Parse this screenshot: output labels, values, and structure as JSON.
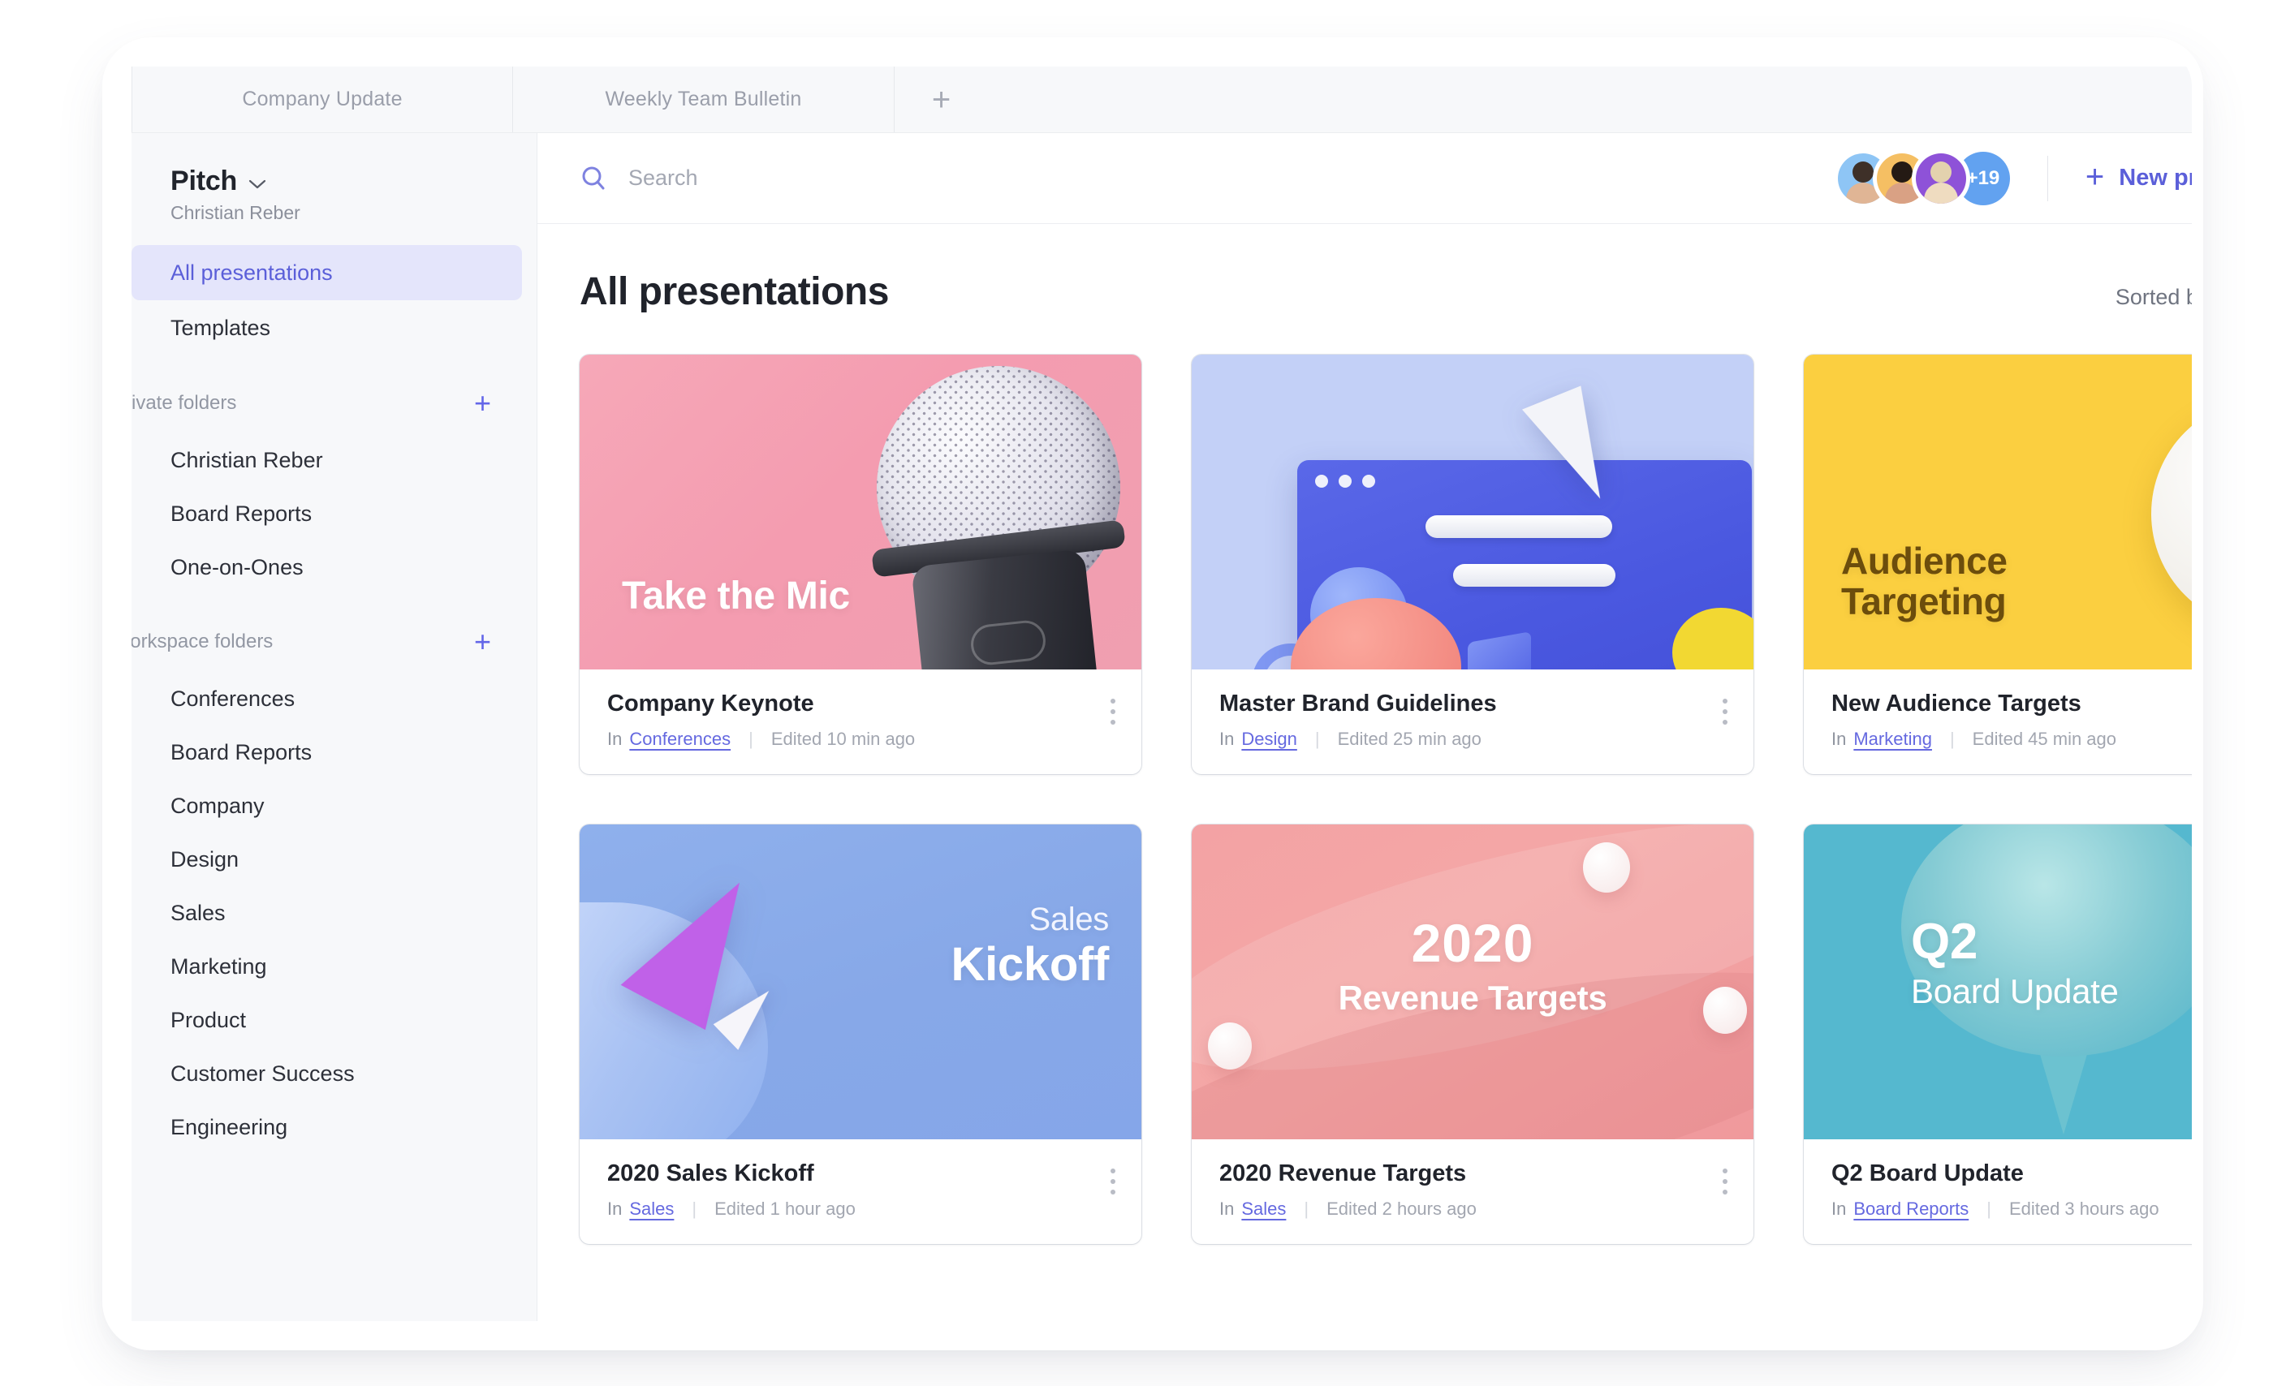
{
  "tabs": [
    {
      "label": "Company Update"
    },
    {
      "label": "Weekly Team Bulletin"
    }
  ],
  "tab_add_label": "+",
  "sidebar": {
    "workspace_name": "Pitch",
    "workspace_caret": "⌄",
    "workspace_owner": "Christian Reber",
    "nav": [
      {
        "label": "All presentations",
        "active": true
      },
      {
        "label": "Templates",
        "active": false
      }
    ],
    "private_section": {
      "label": "Private folders",
      "add_label": "+",
      "folders": [
        {
          "label": "Christian Reber"
        },
        {
          "label": "Board Reports"
        },
        {
          "label": "One-on-Ones"
        }
      ]
    },
    "workspace_section": {
      "label": "Workspace folders",
      "add_label": "+",
      "folders": [
        {
          "label": "Conferences"
        },
        {
          "label": "Board Reports"
        },
        {
          "label": "Company"
        },
        {
          "label": "Design"
        },
        {
          "label": "Sales"
        },
        {
          "label": "Marketing"
        },
        {
          "label": "Product"
        },
        {
          "label": "Customer Success"
        },
        {
          "label": "Engineering"
        }
      ]
    }
  },
  "topbar": {
    "search_placeholder": "Search",
    "search_value": "",
    "avatar_overflow": "+19",
    "new_presentation_label": "New presentation",
    "new_presentation_plus": "+"
  },
  "content": {
    "page_title": "All presentations",
    "sorted_by": "Sorted by last edited",
    "cards": [
      {
        "thumb_title": "Take the Mic",
        "title": "Company Keynote",
        "in_word": "In",
        "folder": "Conferences",
        "separator": "|",
        "edited": "Edited 10 min ago",
        "accent": "#f49cb0"
      },
      {
        "thumb_title": "",
        "title": "Master Brand Guidelines",
        "in_word": "In",
        "folder": "Design",
        "separator": "|",
        "edited": "Edited 25 min ago",
        "accent": "#4a58e0"
      },
      {
        "thumb_title_line1": "Audience",
        "thumb_title_line2": "Targeting",
        "title": "New Audience Targets",
        "in_word": "In",
        "folder": "Marketing",
        "separator": "|",
        "edited": "Edited 45 min ago",
        "accent": "#fbcf40"
      },
      {
        "thumb_title_line1": "Sales",
        "thumb_title_line2": "Kickoff",
        "title": "2020 Sales Kickoff",
        "in_word": "In",
        "folder": "Sales",
        "separator": "|",
        "edited": "Edited 1 hour ago",
        "accent": "#87a8e8"
      },
      {
        "thumb_title_line1": "2020",
        "thumb_title_line2": "Revenue Targets",
        "title": "2020 Revenue Targets",
        "in_word": "In",
        "folder": "Sales",
        "separator": "|",
        "edited": "Edited 2 hours ago",
        "accent": "#f3a2a4"
      },
      {
        "thumb_title_line1": "Q2",
        "thumb_title_line2": "Board Update",
        "title": "Q2 Board Update",
        "in_word": "In",
        "folder": "Board Reports",
        "separator": "|",
        "edited": "Edited 3 hours ago",
        "accent": "#55b8cf"
      }
    ]
  },
  "colors": {
    "accent": "#5b5fd9",
    "sidebar_active_bg": "#e4e5fb",
    "avatar_more_bg": "#62a2f0"
  }
}
